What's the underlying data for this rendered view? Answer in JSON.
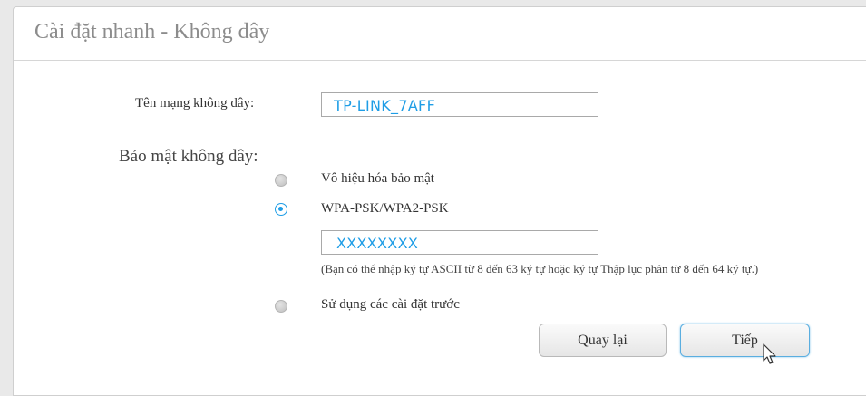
{
  "panel": {
    "title": "Cài đặt nhanh - Không dây"
  },
  "ssid": {
    "label": "Tên mạng không dây:",
    "value": "TP-LINK_7AFF"
  },
  "security": {
    "label": "Bảo mật không dây:",
    "options": [
      {
        "label": "Vô hiệu hóa bảo mật",
        "selected": false
      },
      {
        "label": "WPA-PSK/WPA2-PSK",
        "selected": true
      },
      {
        "label": "Sử dụng các cài đặt trước",
        "selected": false
      }
    ],
    "password_value": "XXXXXXXX",
    "hint": "(Bạn có thể nhập ký tự ASCII từ 8 đến 63 ký tự hoặc ký tự Thập lục phân từ 8 đến 64 ký tự.)"
  },
  "buttons": {
    "back": "Quay lại",
    "next": "Tiếp"
  },
  "colors": {
    "accent": "#1e9de6",
    "title": "#8c8c8c"
  }
}
